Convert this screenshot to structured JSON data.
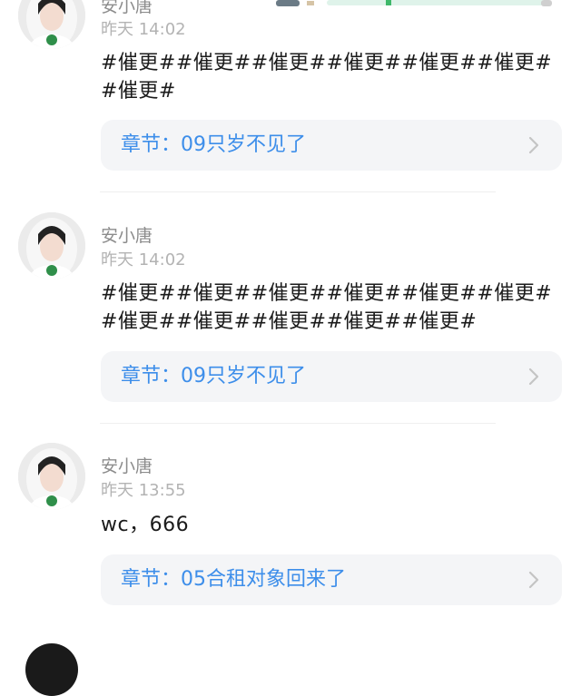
{
  "comments": [
    {
      "username": "安小唐",
      "time": "昨天 14:02",
      "text": "#催更##催更##催更##催更##催更##催更##催更#",
      "chapter": "章节：09只岁不见了"
    },
    {
      "username": "安小唐",
      "time": "昨天 14:02",
      "text": "#催更##催更##催更##催更##催更##催更##催更##催更##催更##催更##催更#",
      "chapter": "章节：09只岁不见了"
    },
    {
      "username": "安小唐",
      "time": "昨天 13:55",
      "text": "wc，666",
      "chapter": "章节：05合租对象回来了"
    }
  ],
  "icons": {
    "avatar": "avatar-photo",
    "chevron": "chevron-right-icon"
  },
  "colors": {
    "chapter_text": "#3d8eea",
    "card_background": "#f4f5f7",
    "username": "#8c8c8c",
    "timestamp": "#b3b3b3",
    "body_text": "#1b1b1b"
  }
}
